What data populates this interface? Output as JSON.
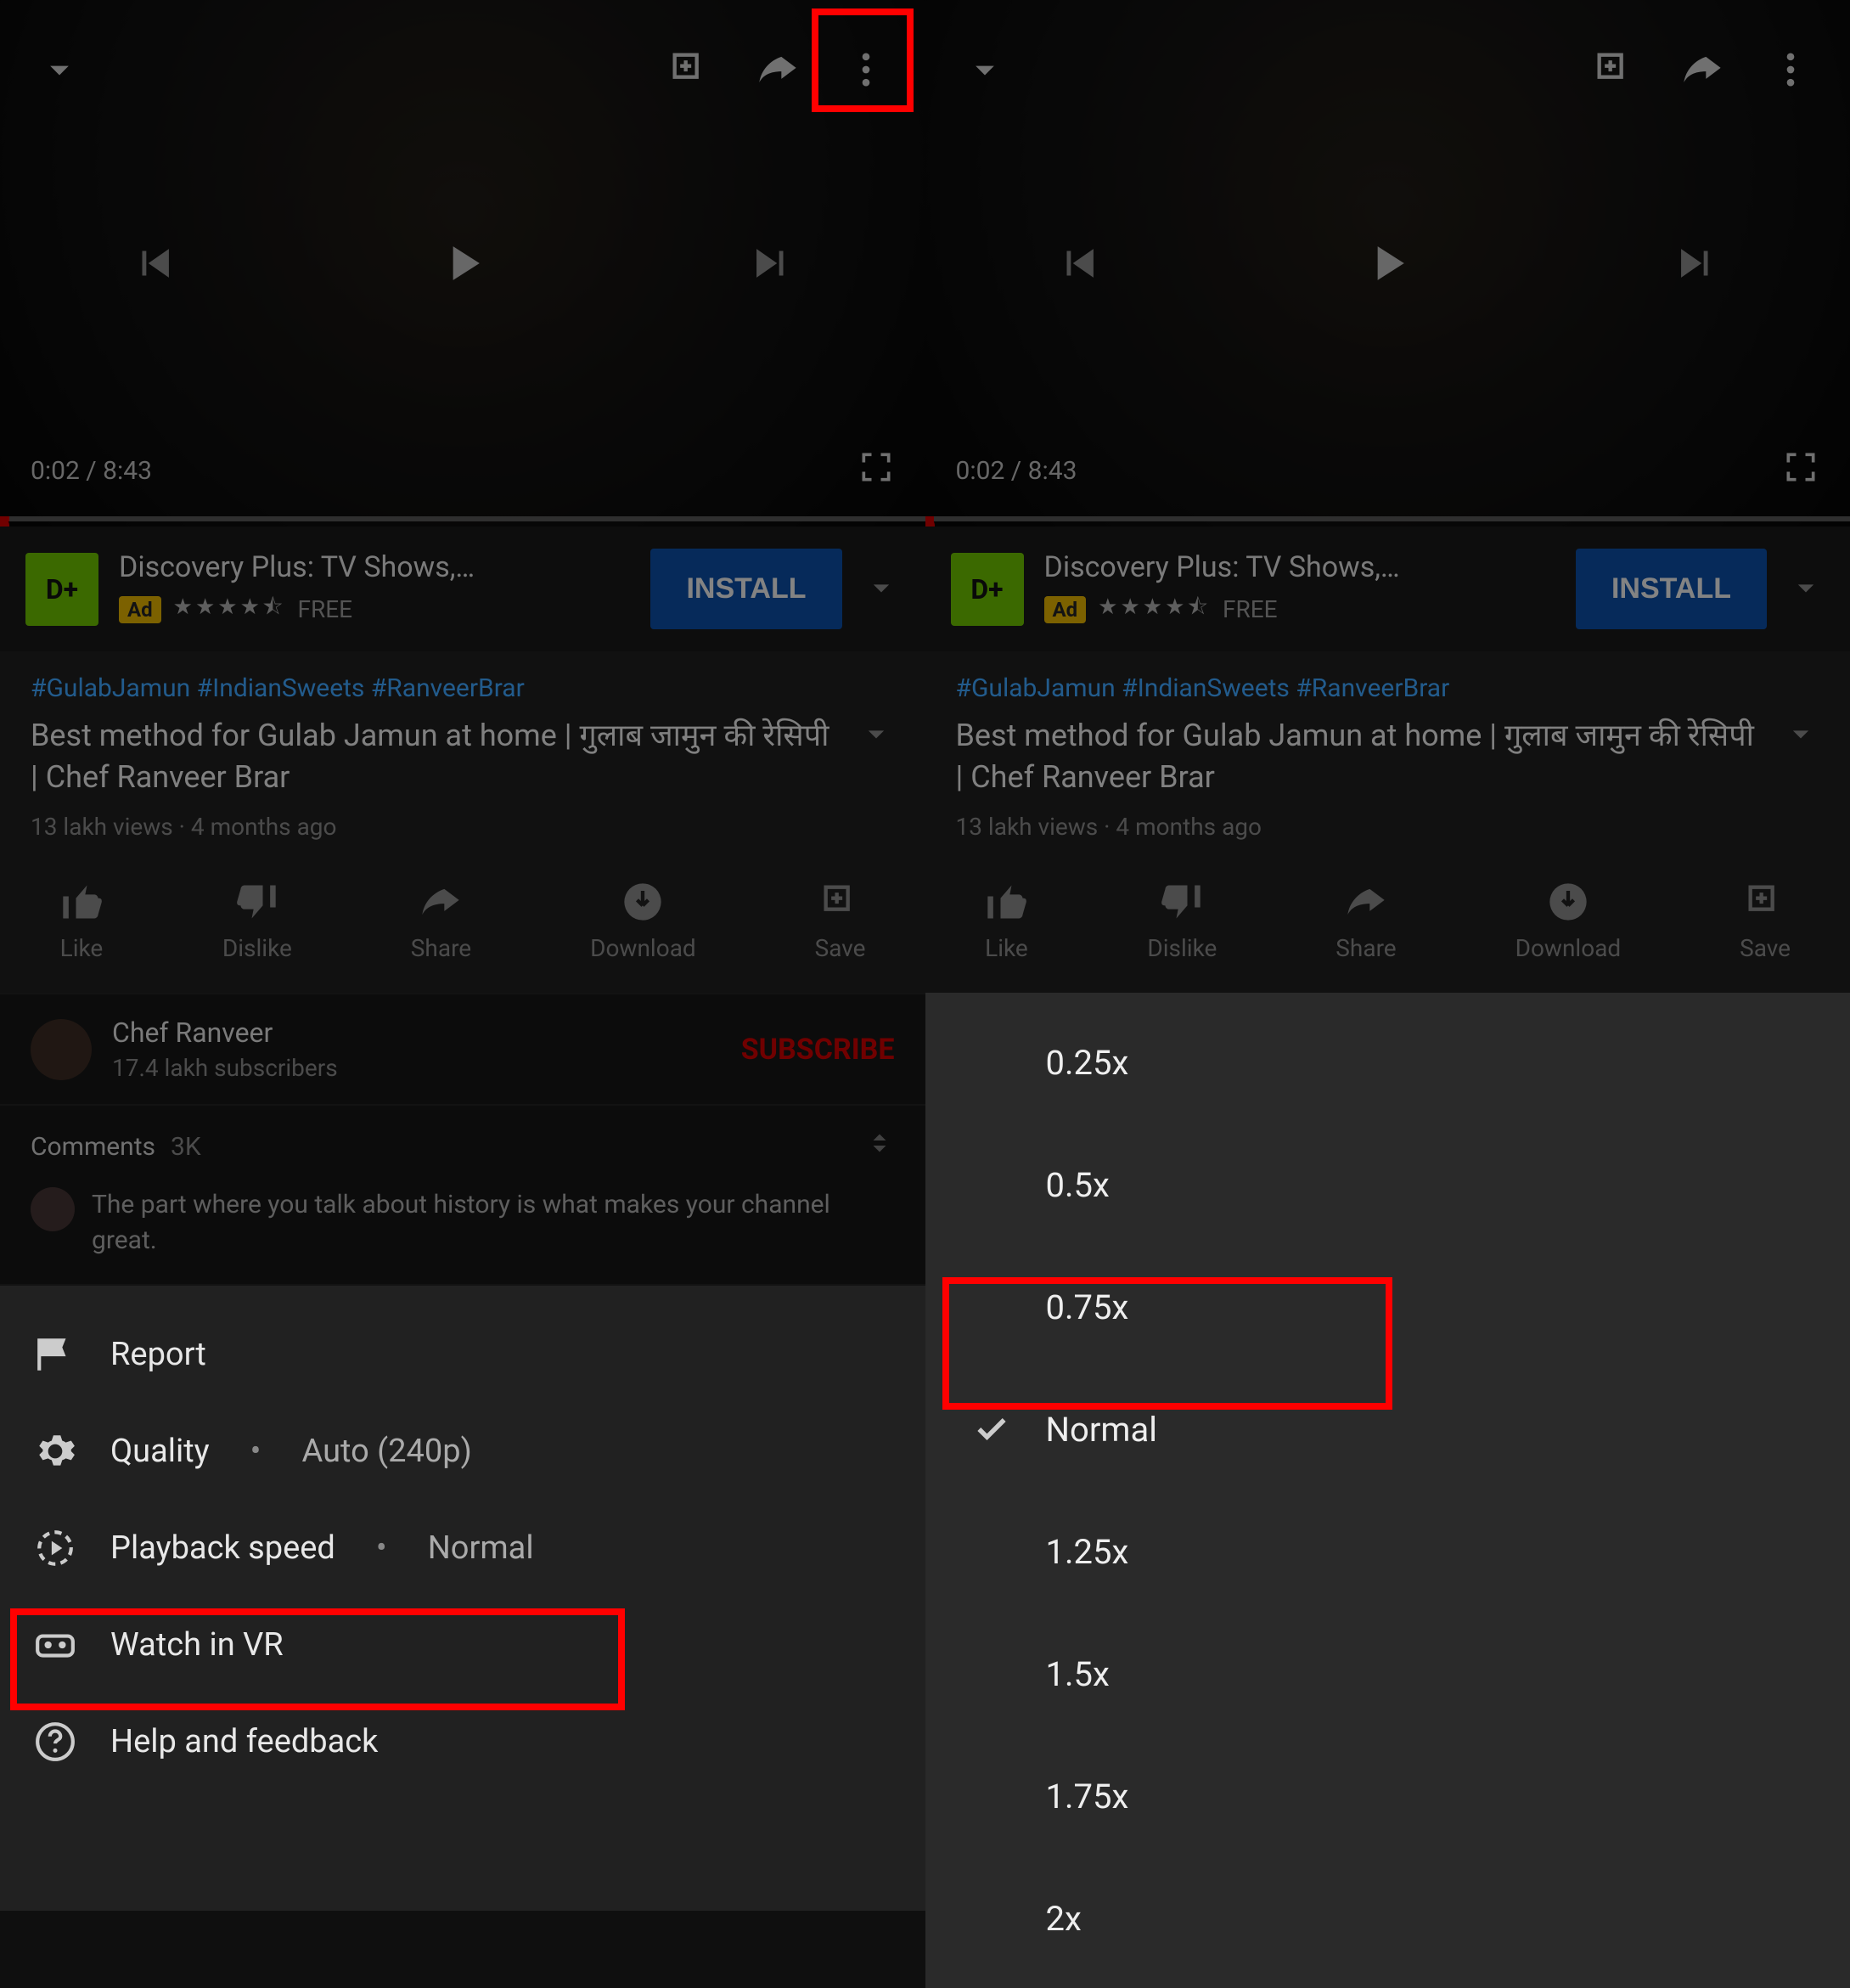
{
  "player": {
    "current_time": "0:02",
    "duration": "8:43"
  },
  "ad": {
    "title": "Discovery Plus: TV Shows,…",
    "badge": "Ad",
    "stars": "★★★★⯪",
    "free": "FREE",
    "install": "INSTALL"
  },
  "video": {
    "hashtags": "#GulabJamun #IndianSweets #RanveerBrar",
    "title": "Best method for Gulab Jamun at home | गुलाब जामुन की रेसिपी | Chef Ranveer Brar",
    "views": "13 lakh views · 4 months ago"
  },
  "actions": {
    "like": "Like",
    "dislike": "Dislike",
    "share": "Share",
    "download": "Download",
    "save": "Save"
  },
  "channel": {
    "name": "Chef Ranveer",
    "subs": "17.4 lakh subscribers",
    "subscribe": "SUBSCRIBE"
  },
  "comments": {
    "label": "Comments",
    "count": "3K",
    "top": "The part where you talk about history is what makes your channel great."
  },
  "menu": {
    "report": "Report",
    "quality": "Quality",
    "quality_value": "Auto (240p)",
    "playback": "Playback speed",
    "playback_value": "Normal",
    "vr": "Watch in VR",
    "help": "Help and feedback"
  },
  "speeds": {
    "s025": "0.25x",
    "s05": "0.5x",
    "s075": "0.75x",
    "normal": "Normal",
    "s125": "1.25x",
    "s15": "1.5x",
    "s175": "1.75x",
    "s2": "2x"
  }
}
